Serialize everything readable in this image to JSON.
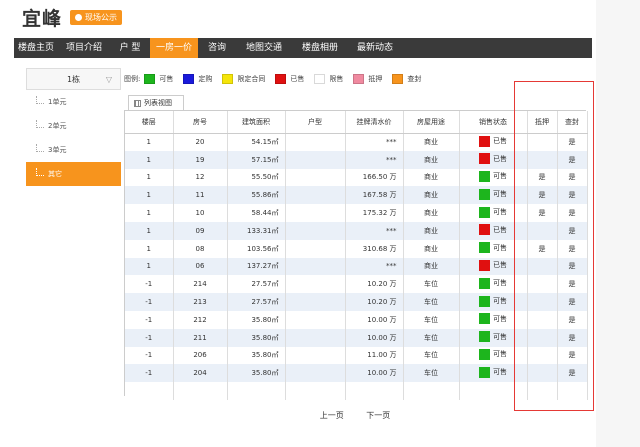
{
  "brand": {
    "title": "宜峰",
    "badge": "现场公示"
  },
  "nav": [
    "楼盘主页",
    "项目介绍",
    "户 型",
    "一房一价",
    "咨询",
    "地图交通",
    "楼盘相册",
    "最新动态"
  ],
  "nav_active": 3,
  "sidebar": {
    "header": "1栋",
    "items": [
      "1单元",
      "2单元",
      "3单元",
      "其它"
    ],
    "active": 3
  },
  "legend": {
    "title": "图例:",
    "items": [
      {
        "label": "可售",
        "color": "#1db51d"
      },
      {
        "label": "定购",
        "color": "#1a1adb"
      },
      {
        "label": "限定合同",
        "color": "#f5e50a"
      },
      {
        "label": "已售",
        "color": "#e01010"
      },
      {
        "label": "限售",
        "color": "#ffffff"
      },
      {
        "label": "抵押",
        "color": "#f08aa0"
      },
      {
        "label": "查封",
        "color": "#f7941d"
      }
    ]
  },
  "tab": {
    "label": "列表视图"
  },
  "table": {
    "headers": [
      "楼层",
      "房号",
      "建筑面积",
      "户型",
      "挂牌清水价",
      "房屋用途",
      "销售状态",
      "抵押",
      "查封"
    ],
    "rows": [
      [
        "1",
        "20",
        "54.15㎡",
        "",
        "***",
        "商业",
        "已售",
        "",
        "是"
      ],
      [
        "1",
        "19",
        "57.15㎡",
        "",
        "***",
        "商业",
        "已售",
        "",
        "是"
      ],
      [
        "1",
        "12",
        "55.50㎡",
        "",
        "166.50 万",
        "商业",
        "可售",
        "是",
        "是"
      ],
      [
        "1",
        "11",
        "55.86㎡",
        "",
        "167.58 万",
        "商业",
        "可售",
        "是",
        "是"
      ],
      [
        "1",
        "10",
        "58.44㎡",
        "",
        "175.32 万",
        "商业",
        "可售",
        "是",
        "是"
      ],
      [
        "1",
        "09",
        "133.31㎡",
        "",
        "***",
        "商业",
        "已售",
        "",
        "是"
      ],
      [
        "1",
        "08",
        "103.56㎡",
        "",
        "310.68 万",
        "商业",
        "可售",
        "是",
        "是"
      ],
      [
        "1",
        "06",
        "137.27㎡",
        "",
        "***",
        "商业",
        "已售",
        "",
        "是"
      ],
      [
        "-1",
        "214",
        "27.57㎡",
        "",
        "10.20 万",
        "车位",
        "可售",
        "",
        "是"
      ],
      [
        "-1",
        "213",
        "27.57㎡",
        "",
        "10.20 万",
        "车位",
        "可售",
        "",
        "是"
      ],
      [
        "-1",
        "212",
        "35.80㎡",
        "",
        "10.00 万",
        "车位",
        "可售",
        "",
        "是"
      ],
      [
        "-1",
        "211",
        "35.80㎡",
        "",
        "10.00 万",
        "车位",
        "可售",
        "",
        "是"
      ],
      [
        "-1",
        "206",
        "35.80㎡",
        "",
        "11.00 万",
        "车位",
        "可售",
        "",
        "是"
      ],
      [
        "-1",
        "204",
        "35.80㎡",
        "",
        "10.00 万",
        "车位",
        "可售",
        "",
        "是"
      ],
      [
        "",
        "",
        "",
        "",
        "",
        "",
        "",
        "",
        ""
      ]
    ]
  },
  "status_colors": {
    "已售": "#e01010",
    "可售": "#1db51d"
  },
  "pager": {
    "prev": "上一页",
    "next": "下一页"
  }
}
